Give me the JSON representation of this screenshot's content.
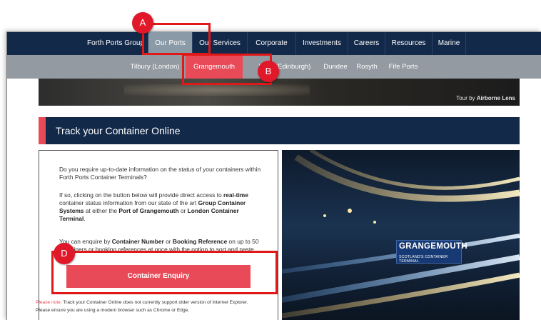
{
  "primary_nav": [
    "Forth Ports Group",
    "Our Ports",
    "Our Services",
    "Corporate",
    "Investments",
    "Careers",
    "Resources",
    "Marine"
  ],
  "secondary_nav": [
    "Tilbury (London)",
    "Grangemouth",
    "Leith (Edinburgh)",
    "Dundee",
    "Rosyth",
    "Fife Ports"
  ],
  "hero": {
    "credit_prefix": "Tour by ",
    "credit_name": "Airborne Lens"
  },
  "section": {
    "title": "Track your Container Online"
  },
  "panel": {
    "p1": "Do you require up-to-date information on the status of your containers within Forth Ports Container Terminals?",
    "p2_a": "If so, clicking on the button below will provide direct access to ",
    "p2_b": "real-time",
    "p2_c": " container status information from our state of the art ",
    "p2_d": "Group Container Systems",
    "p2_e": " at either the ",
    "p2_f": "Port of Grangemouth",
    "p2_g": " or ",
    "p2_h": "London Container Terminal",
    "p2_i": ".",
    "p3_a": "You can enquire by ",
    "p3_b": "Container Number",
    "p3_c": " or ",
    "p3_d": "Booking Reference",
    "p3_e": " on up to 50 containers or booking references at once with the option to sort and paste.",
    "button": "Container Enquiry"
  },
  "note": {
    "label": "Please note:",
    "line1": " Track your Container Online does not currently support older version of Internet Explorer.",
    "line2": "Please ensure you are using a modern browser such as Chrome or Edge."
  },
  "photo": {
    "sign_line1": "GRANGEMOUTH",
    "sign_line2": "SCOTLAND'S CONTAINER TERMINAL"
  },
  "annotations": {
    "a": "A",
    "b": "B",
    "d": "D"
  },
  "colors": {
    "navy": "#13294a",
    "accent": "#e84a57",
    "subnav": "#939aa1",
    "annotation": "#e01818"
  }
}
